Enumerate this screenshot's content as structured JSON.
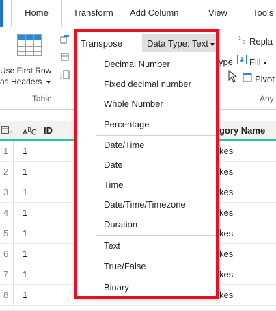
{
  "ribbon_tabs": [
    "Home",
    "Transform",
    "Add Column",
    "View",
    "Tools"
  ],
  "ribbon": {
    "use_first_row_line1": "Use First Row",
    "use_first_row_line2": "as Headers",
    "table_group": "Table",
    "any_group": "Any",
    "replace_fragment": "Repla",
    "type_fragment": "ype",
    "fill_label": "Fill",
    "pivot_fragment": "Pivot"
  },
  "grid": {
    "col1_type": "A",
    "col1_type_sup": "B",
    "col1_type_sub": "C",
    "col1_name": "ID",
    "col2_name_fragment": "gory Name",
    "rows": [
      {
        "n": "1",
        "id": "1",
        "cat": "kes"
      },
      {
        "n": "2",
        "id": "1",
        "cat": "kes"
      },
      {
        "n": "3",
        "id": "1",
        "cat": "kes"
      },
      {
        "n": "4",
        "id": "1",
        "cat": "kes"
      },
      {
        "n": "5",
        "id": "1",
        "cat": "kes"
      },
      {
        "n": "6",
        "id": "1",
        "cat": "kes"
      },
      {
        "n": "7",
        "id": "1",
        "cat": "kes"
      },
      {
        "n": "8",
        "id": "1",
        "cat": "kes"
      }
    ]
  },
  "menu": {
    "transpose": "Transpose",
    "data_type": "Data Type: Text",
    "items": [
      "Decimal Number",
      "Fixed decimal number",
      "Whole Number",
      "Percentage",
      "Date/Time",
      "Date",
      "Time",
      "Date/Time/Timezone",
      "Duration",
      "Text",
      "True/False",
      "Binary"
    ]
  },
  "colors": {
    "highlight_border": "#e81123",
    "accent_bar": "#2cc2a6",
    "tab_edge": "#1b74c5"
  }
}
